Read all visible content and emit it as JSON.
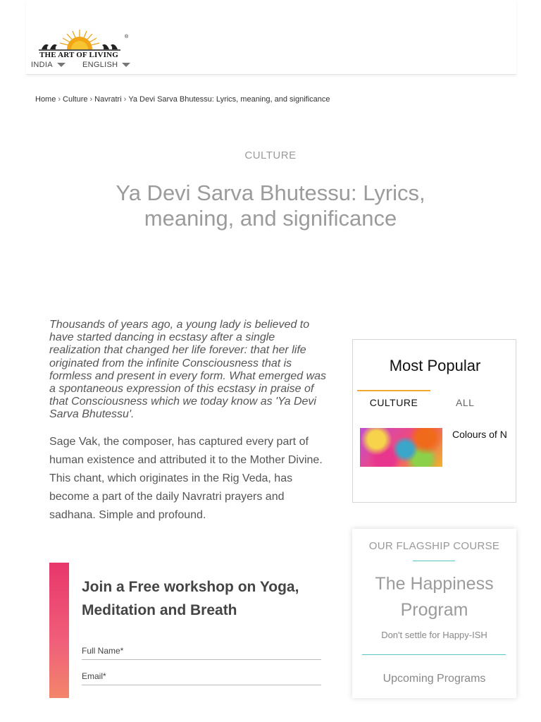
{
  "header": {
    "logo_text": "THE ART OF LIVING",
    "logo_reg": "®",
    "country": "INDIA",
    "language": "ENGLISH"
  },
  "breadcrumb": {
    "home": "Home",
    "culture": "Culture",
    "navratri": "Navratri",
    "current": "Ya Devi Sarva Bhutessu: Lyrics, meaning, and significance",
    "separator": "›"
  },
  "article": {
    "category": "CULTURE",
    "title": "Ya Devi Sarva Bhutessu: Lyrics, meaning, and significance",
    "lead": "Thousands of years ago, a young lady is believed to have started dancing in ecstasy after a single realization that changed her life forever: that her life originated from the infinite Consciousness that is formless and present in every form. What emerged was a spontaneous expression of this ecstasy in praise of that Consciousness which we today know as 'Ya Devi Sarva Bhutessu'.",
    "body": "Sage Vak, the composer, has captured every part of human existence and attributed it to the Mother Divine. This chant, which originates in the Rig Veda, has become a part of the daily Navratri prayers and sadhana. Simple and profound."
  },
  "workshop": {
    "heading": "Join a Free workshop on Yoga, Meditation and Breath",
    "full_name_label": "Full Name*",
    "email_label": "Email*"
  },
  "popular": {
    "heading": "Most Popular",
    "tab_culture": "CULTURE",
    "tab_all": "ALL",
    "item_title": "Colours of N"
  },
  "flagship": {
    "label": "OUR FLAGSHIP COURSE",
    "title": "The Happiness Program",
    "subtitle": "Don't settle for Happy-ISH",
    "upcoming": "Upcoming Programs"
  },
  "colors": {
    "accent_teal": "#58c7c4",
    "accent_orange": "#f0a830",
    "accent_pink": "#e8366b"
  }
}
